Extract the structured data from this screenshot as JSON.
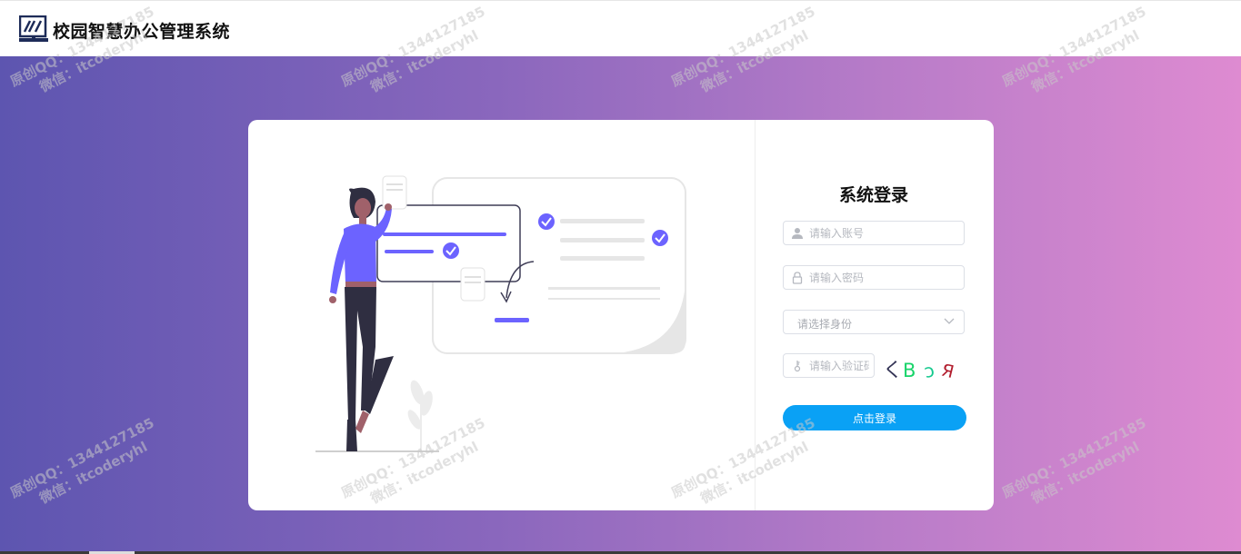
{
  "header": {
    "app_title": "校园智慧办公管理系统",
    "logo_icon": "school-logo-icon"
  },
  "login": {
    "title": "系统登录",
    "account_placeholder": "请输入账号",
    "password_placeholder": "请输入密码",
    "role_placeholder": "请选择身份",
    "captcha_placeholder": "请输入验证码",
    "captcha_chars": [
      "く",
      "B",
      "ɔ",
      "Я"
    ],
    "captcha_colors": [
      "#333355",
      "#19d46a",
      "#14c98d",
      "#b21e2e"
    ],
    "submit_label": "点击登录"
  },
  "colors": {
    "accent": "#0aa1f5",
    "illustration_accent": "#6c63ff",
    "gradient_start": "#5d55b0",
    "gradient_end": "#de8bd1"
  },
  "watermark": {
    "line1": "原创QQ：1344127185",
    "line2": "微信：itcoderyhl"
  }
}
